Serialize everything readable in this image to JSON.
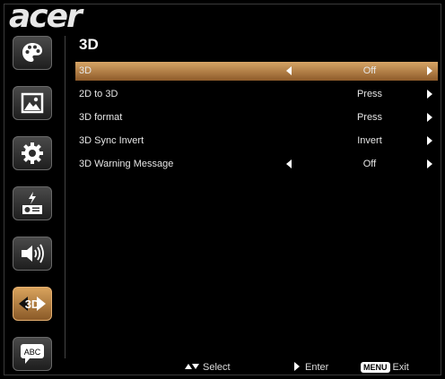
{
  "brand": "acer",
  "page_title": "3D",
  "sidebar": {
    "items": [
      {
        "name": "color-palette-icon",
        "active": false
      },
      {
        "name": "image-icon",
        "active": false
      },
      {
        "name": "settings-gear-icon",
        "active": false
      },
      {
        "name": "power-management-icon",
        "active": false
      },
      {
        "name": "audio-speaker-icon",
        "active": false
      },
      {
        "name": "3d-icon",
        "active": true,
        "text": "3D"
      },
      {
        "name": "language-abc-icon",
        "active": false,
        "text": "ABC"
      }
    ]
  },
  "menu": {
    "items": [
      {
        "label": "3D",
        "value": "Off",
        "has_left_arrow": true,
        "selected": true
      },
      {
        "label": "2D to 3D",
        "value": "Press",
        "has_left_arrow": false,
        "selected": false
      },
      {
        "label": "3D format",
        "value": "Press",
        "has_left_arrow": false,
        "selected": false
      },
      {
        "label": "3D Sync Invert",
        "value": "Invert",
        "has_left_arrow": false,
        "selected": false
      },
      {
        "label": "3D Warning Message",
        "value": "Off",
        "has_left_arrow": true,
        "selected": false
      }
    ]
  },
  "footer": {
    "select_label": "Select",
    "enter_label": "Enter",
    "menu_key": "MENU",
    "exit_label": "Exit"
  },
  "colors": {
    "accent": "#c48a48",
    "background": "#000000"
  }
}
